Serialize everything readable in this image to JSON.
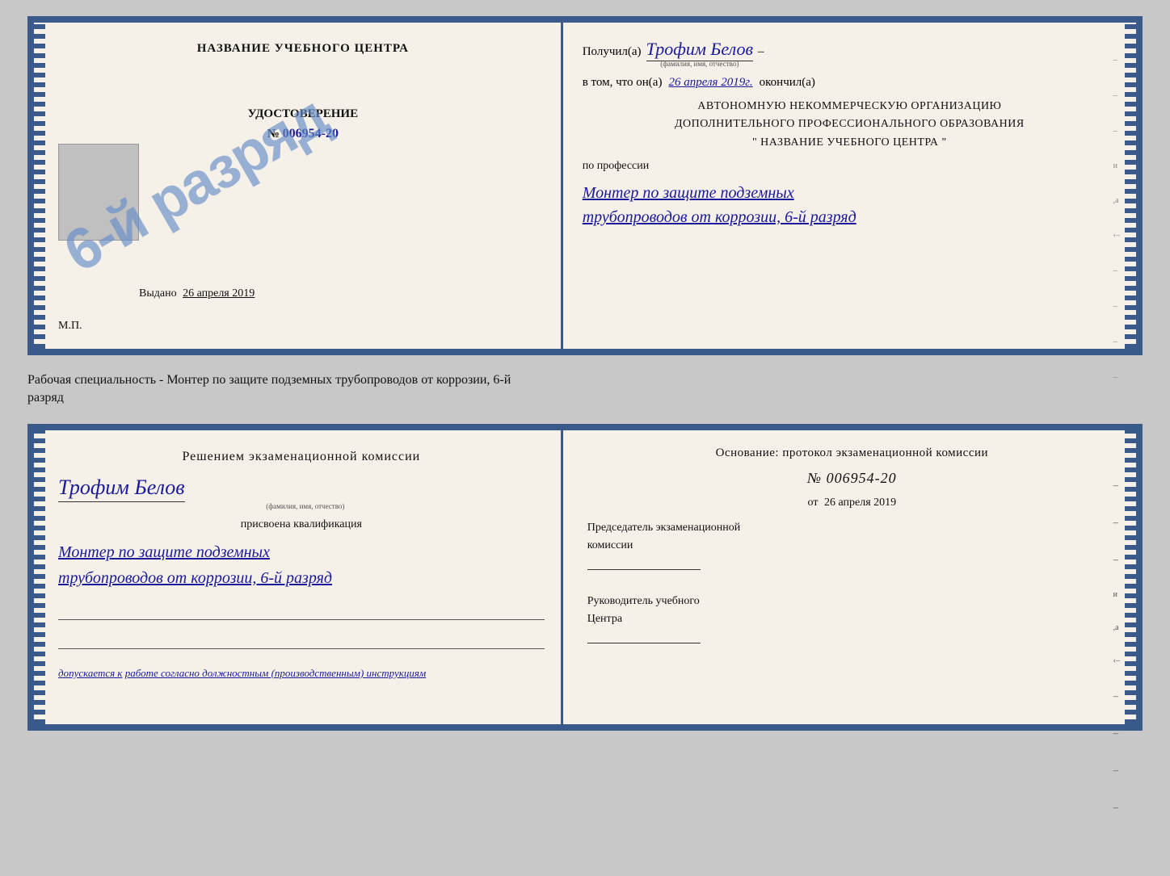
{
  "page": {
    "background_color": "#c8c8c8"
  },
  "cert_top": {
    "left": {
      "title": "НАЗВАНИЕ УЧЕБНОГО ЦЕНТРА",
      "stamp_text": "6-й разряд",
      "udostoverenie_label": "УДОСТОВЕРЕНИЕ",
      "number_label": "№",
      "number_value": "006954-20",
      "vydano_label": "Выдано",
      "vydano_date": "26 апреля 2019",
      "mp_label": "М.П."
    },
    "right": {
      "poluchil_label": "Получил(a)",
      "poluchil_name": "Трофим Белов",
      "fio_label": "(фамилия, имя, отчество)",
      "vtom_label": "в том, что он(а)",
      "vtom_date": "26 апреля 2019г.",
      "okonchil_label": "окончил(а)",
      "org_line1": "АВТОНОМНУЮ НЕКОММЕРЧЕСКУЮ ОРГАНИЗАЦИЮ",
      "org_line2": "ДОПОЛНИТЕЛЬНОГО ПРОФЕССИОНАЛЬНОГО ОБРАЗОВАНИЯ",
      "org_line3": "\"  НАЗВАНИЕ УЧЕБНОГО ЦЕНТРА  \"",
      "po_professii": "по профессии",
      "professiya_line1": "Монтер по защите подземных",
      "professiya_line2": "трубопроводов от коррозии, 6-й разряд"
    }
  },
  "separator": {
    "text_line1": "Рабочая специальность - Монтер по защите подземных трубопроводов от коррозии, 6-й",
    "text_line2": "разряд"
  },
  "cert_bottom": {
    "left": {
      "reshenie_label": "Решением экзаменационной комиссии",
      "name_value": "Трофим Белов",
      "fio_label": "(фамилия, имя, отчество)",
      "prisvoena_label": "присвоена квалификация",
      "qual_line1": "Монтер по защите подземных",
      "qual_line2": "трубопроводов от коррозии, 6-й разряд",
      "dopuskaetsya_label": "допускается к",
      "dopuskaetsya_value": "работе согласно должностным (производственным) инструкциям"
    },
    "right": {
      "osnovanie_label": "Основание: протокол экзаменационной комиссии",
      "protokol_number": "№  006954-20",
      "ot_label": "от",
      "ot_date": "26 апреля 2019",
      "predsedatel_line1": "Председатель экзаменационной",
      "predsedatel_line2": "комиссии",
      "rukovoditel_line1": "Руководитель учебного",
      "rukovoditel_line2": "Центра"
    }
  }
}
